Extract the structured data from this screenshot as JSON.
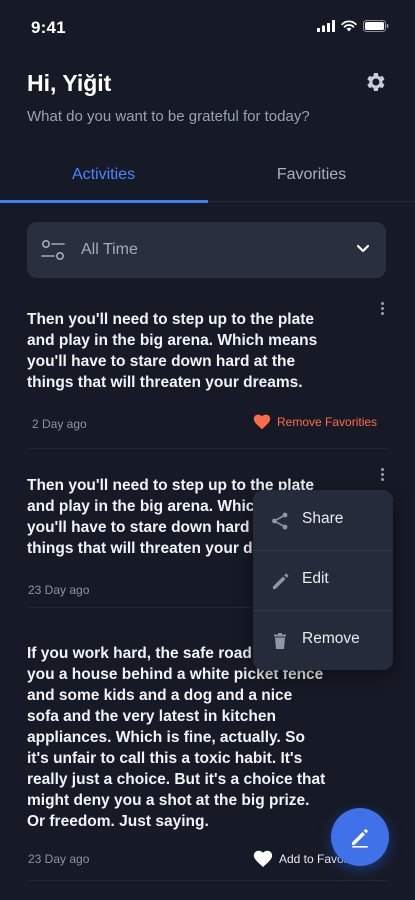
{
  "status": {
    "time": "9:41"
  },
  "header": {
    "greeting": "Hi, Yiğit",
    "subtitle": "What do you want to be grateful for today?"
  },
  "tabs": [
    {
      "label": "Activities",
      "active": true
    },
    {
      "label": "Favorities",
      "active": false
    }
  ],
  "filter": {
    "label": "All Time"
  },
  "cards": [
    {
      "text": "Then you'll need to step up to the plate and play in the big arena. Which means you'll have to stare down hard at the things that will threaten your dreams.",
      "date": "2 Day ago",
      "favorite_label": "Remove Favorities",
      "favorited": true
    },
    {
      "text": "Then you'll need to step up to the plate and play in the big arena. Which means you'll have to stare down hard at the things that will threaten your dreams.",
      "date": "23 Day ago"
    },
    {
      "text": "If you work hard, the safe road will get you a house behind a white picket fence and some kids and a dog and a nice sofa and the very latest in kitchen appliances. Which is fine, actually. So it's unfair to call this a toxic habit. It's really just a choice. But it's a choice that might deny you a shot at the big prize. Or freedom. Just saying.",
      "date": "23 Day ago",
      "favorite_label": "Add to Favorities",
      "favorited": false
    }
  ],
  "context_menu": {
    "items": [
      {
        "label": "Share",
        "icon": "share-icon"
      },
      {
        "label": "Edit",
        "icon": "pencil-icon"
      },
      {
        "label": "Remove",
        "icon": "trash-icon"
      }
    ]
  },
  "colors": {
    "background": "#161a26",
    "accent": "#3f7df5",
    "favorite": "#ff6b4a"
  }
}
